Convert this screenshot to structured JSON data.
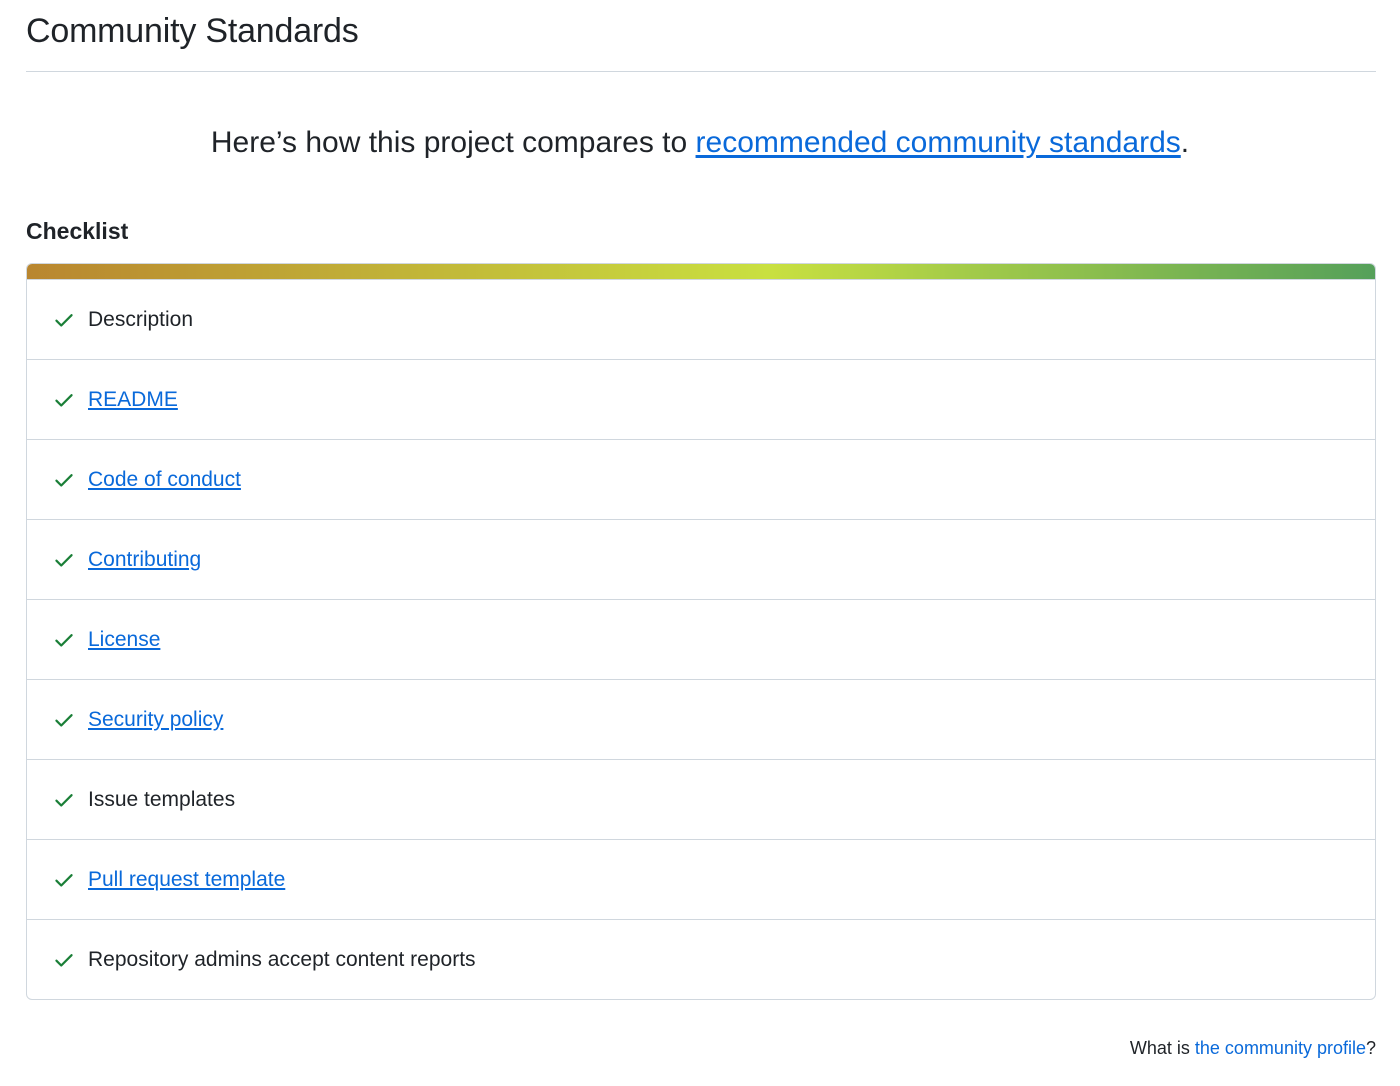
{
  "header": {
    "title": "Community Standards"
  },
  "intro": {
    "prefix": "Here’s how this project compares to ",
    "link_text": "recommended community standards",
    "suffix": "."
  },
  "checklist": {
    "heading": "Checklist",
    "progress_percent": 100,
    "colors": {
      "gradient_start": "#b9862f",
      "gradient_mid": "#c9e040",
      "gradient_end": "#55a05a",
      "check": "#1a7f37",
      "link": "#0969da"
    },
    "items": [
      {
        "label": "Description",
        "is_link": false,
        "status": "check-icon"
      },
      {
        "label": "README",
        "is_link": true,
        "status": "check-icon"
      },
      {
        "label": "Code of conduct",
        "is_link": true,
        "status": "check-icon"
      },
      {
        "label": "Contributing",
        "is_link": true,
        "status": "check-icon"
      },
      {
        "label": "License",
        "is_link": true,
        "status": "check-icon"
      },
      {
        "label": "Security policy",
        "is_link": true,
        "status": "check-icon"
      },
      {
        "label": "Issue templates",
        "is_link": false,
        "status": "check-icon"
      },
      {
        "label": "Pull request template",
        "is_link": true,
        "status": "check-icon"
      },
      {
        "label": "Repository admins accept content reports",
        "is_link": false,
        "status": "check-icon"
      }
    ]
  },
  "footer": {
    "prefix": "What is ",
    "link_text": "the community profile",
    "suffix": "?"
  }
}
